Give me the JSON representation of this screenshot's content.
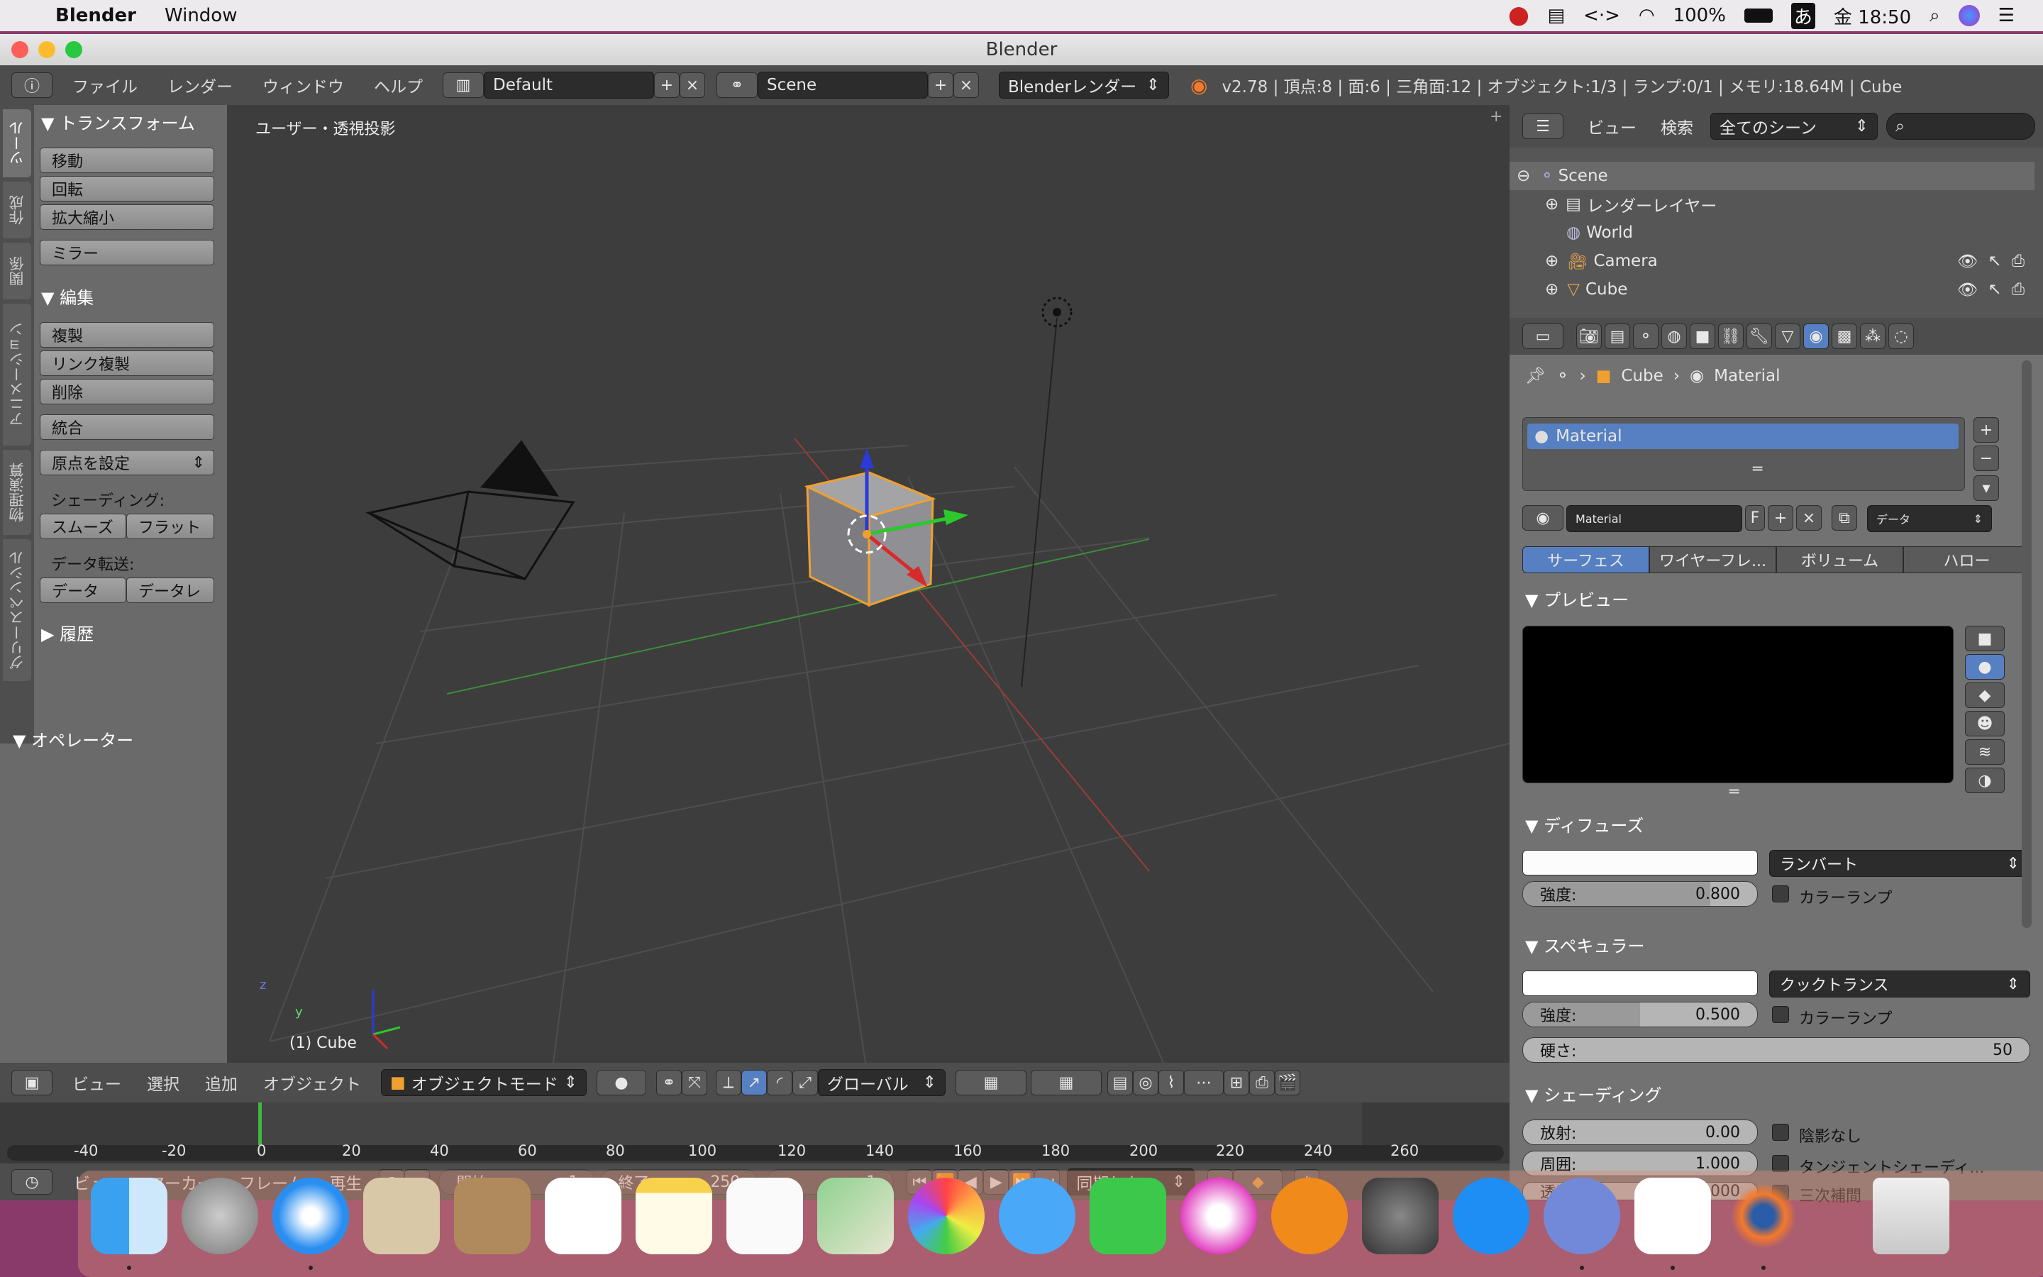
{
  "menubar": {
    "app": "Blender",
    "window": "Window",
    "battery": "100%",
    "ime": "あ",
    "clock": "金 18:50"
  },
  "window": {
    "title": "Blender"
  },
  "header": {
    "menus": [
      "ファイル",
      "レンダー",
      "ウィンドウ",
      "ヘルプ"
    ],
    "layout": "Default",
    "scene": "Scene",
    "engine": "Blenderレンダー",
    "stats": "v2.78 | 頂点:8 | 面:6 | 三角面:12 | オブジェクト:1/3 | ランプ:0/1 | メモリ:18.64M | Cube"
  },
  "toolshelf": {
    "tabs": [
      "ツール",
      "作成",
      "関係",
      "アニメーション",
      "物理演算",
      "グリースペンシル"
    ],
    "transform": {
      "title": "トランスフォーム",
      "buttons": [
        "移動",
        "回転",
        "拡大縮小"
      ],
      "mirror": "ミラー"
    },
    "edit": {
      "title": "編集",
      "buttons": [
        "複製",
        "リンク複製",
        "削除"
      ],
      "join": "統合",
      "origin": "原点を設定",
      "shading_label": "シェーディング:",
      "smooth": "スムーズ",
      "flat": "フラット",
      "data_label": "データ転送:",
      "data": "データ",
      "data_layout": "データレ"
    },
    "history": "履歴",
    "operator": "オペレーター"
  },
  "viewport": {
    "label": "ユーザー・透視投影",
    "object": "(1) Cube",
    "axis_z": "z",
    "axis_y": "y"
  },
  "viewbar": {
    "menus": [
      "ビュー",
      "選択",
      "追加",
      "オブジェクト"
    ],
    "mode": "オブジェクトモード",
    "orient": "グローバル"
  },
  "timeline": {
    "ticks": [
      "-40",
      "-20",
      "0",
      "20",
      "40",
      "60",
      "80",
      "100",
      "120",
      "140",
      "160",
      "180",
      "200",
      "220",
      "240",
      "260"
    ],
    "menus": [
      "ビュー",
      "マーカー",
      "フレーム",
      "再生"
    ],
    "start_label": "開始:",
    "start": "1",
    "end_label": "終了:",
    "end": "250",
    "current": "1",
    "sync": "同期しない"
  },
  "outliner": {
    "menus": [
      "ビュー",
      "検索"
    ],
    "filter": "全てのシーン",
    "rows": [
      "Scene",
      "レンダーレイヤー",
      "World",
      "Camera",
      "Cube"
    ]
  },
  "properties": {
    "breadcrumb": [
      "Cube",
      "Material"
    ],
    "slot": "Material",
    "material_name": "Material",
    "fake": "F",
    "link": "データ",
    "tabs": [
      "サーフェス",
      "ワイヤーフレ...",
      "ボリューム",
      "ハロー"
    ],
    "preview": "プレビュー",
    "diffuse": {
      "title": "ディフューズ",
      "shader": "ランバート",
      "intensity_label": "強度:",
      "intensity": "0.800",
      "ramp": "カラーランプ",
      "intensity_fraction": 0.8
    },
    "specular": {
      "title": "スペキュラー",
      "shader": "クックトランス",
      "intensity_label": "強度:",
      "intensity": "0.500",
      "ramp": "カラーランプ",
      "hardness_label": "硬さ:",
      "hardness": "50",
      "intensity_fraction": 0.5
    },
    "shading": {
      "title": "シェーディング",
      "emit_label": "放射:",
      "emit": "0.00",
      "ambient_label": "周囲:",
      "ambient": "1.000",
      "translucency_label": "透光性:",
      "translucency": "0.000",
      "shadeless": "陰影なし",
      "tangent": "タンジェントシェーディ...",
      "cubic": "三次補間"
    }
  },
  "colors": {
    "accent": "#5680c2",
    "selected_orange": "#f0a030",
    "grid": "#4a4a4a"
  }
}
